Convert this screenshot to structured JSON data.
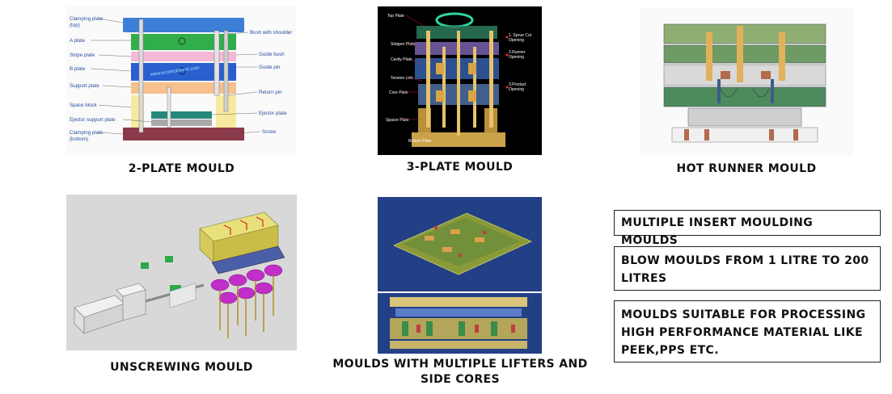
{
  "captions": {
    "two_plate": "2-PLATE MOULD",
    "three_plate": "3-PLATE MOULD",
    "hot_runner": "HOT RUNNER MOULD",
    "unscrewing": "UNSCREWING MOULD",
    "lifters": "MOULDS WITH MULTIPLE LIFTERS AND SIDE CORES"
  },
  "boxes": {
    "insert": "MULTIPLE INSERT MOULDING MOULDS",
    "blow": "BLOW MOULDS FROM 1 LITRE TO 200 LITRES",
    "high_perf": "MOULDS SUITABLE FOR PROCESSING HIGH PERFORMANCE MATERIAL LIKE PEEK,PPS ETC."
  },
  "two_plate_labels": {
    "clamping_top": "Clamping plate",
    "clamping_top_sub": "(top)",
    "a_plate": "A plate",
    "stripe_plate": "Stripe plate",
    "b_plate": "B plate",
    "support_plate": "Support plate",
    "space_block": "Space block",
    "ejector_support": "Ejector support plate",
    "clamping_bottom": "Clamping plate",
    "clamping_bottom_sub": "(bottom)",
    "bush": "Bush with shoulder",
    "guide_bush": "Guide bush",
    "guide_pin": "Guide pin",
    "return_pin": "Return pin",
    "ejector_plate": "Ejector plate",
    "screw": "Screw",
    "watermark": "www.ecomoldinmt.com"
  },
  "three_plate_labels": {
    "top_plate": "Top Plate",
    "stripper_plate": "Stripper Plate",
    "cavity_plate": "Cavity Plate",
    "tension_link": "Tension Link",
    "core_plate": "Core Plate",
    "spacer_plate": "Spacer Plate",
    "bottom_plate": "Bottom Plate",
    "opening1": "1. Sprue Cut",
    "opening1b": "Opening",
    "opening2": "2.Runner",
    "opening2b": "Opening",
    "opening3": "3.Product",
    "opening3b": "Opening"
  }
}
